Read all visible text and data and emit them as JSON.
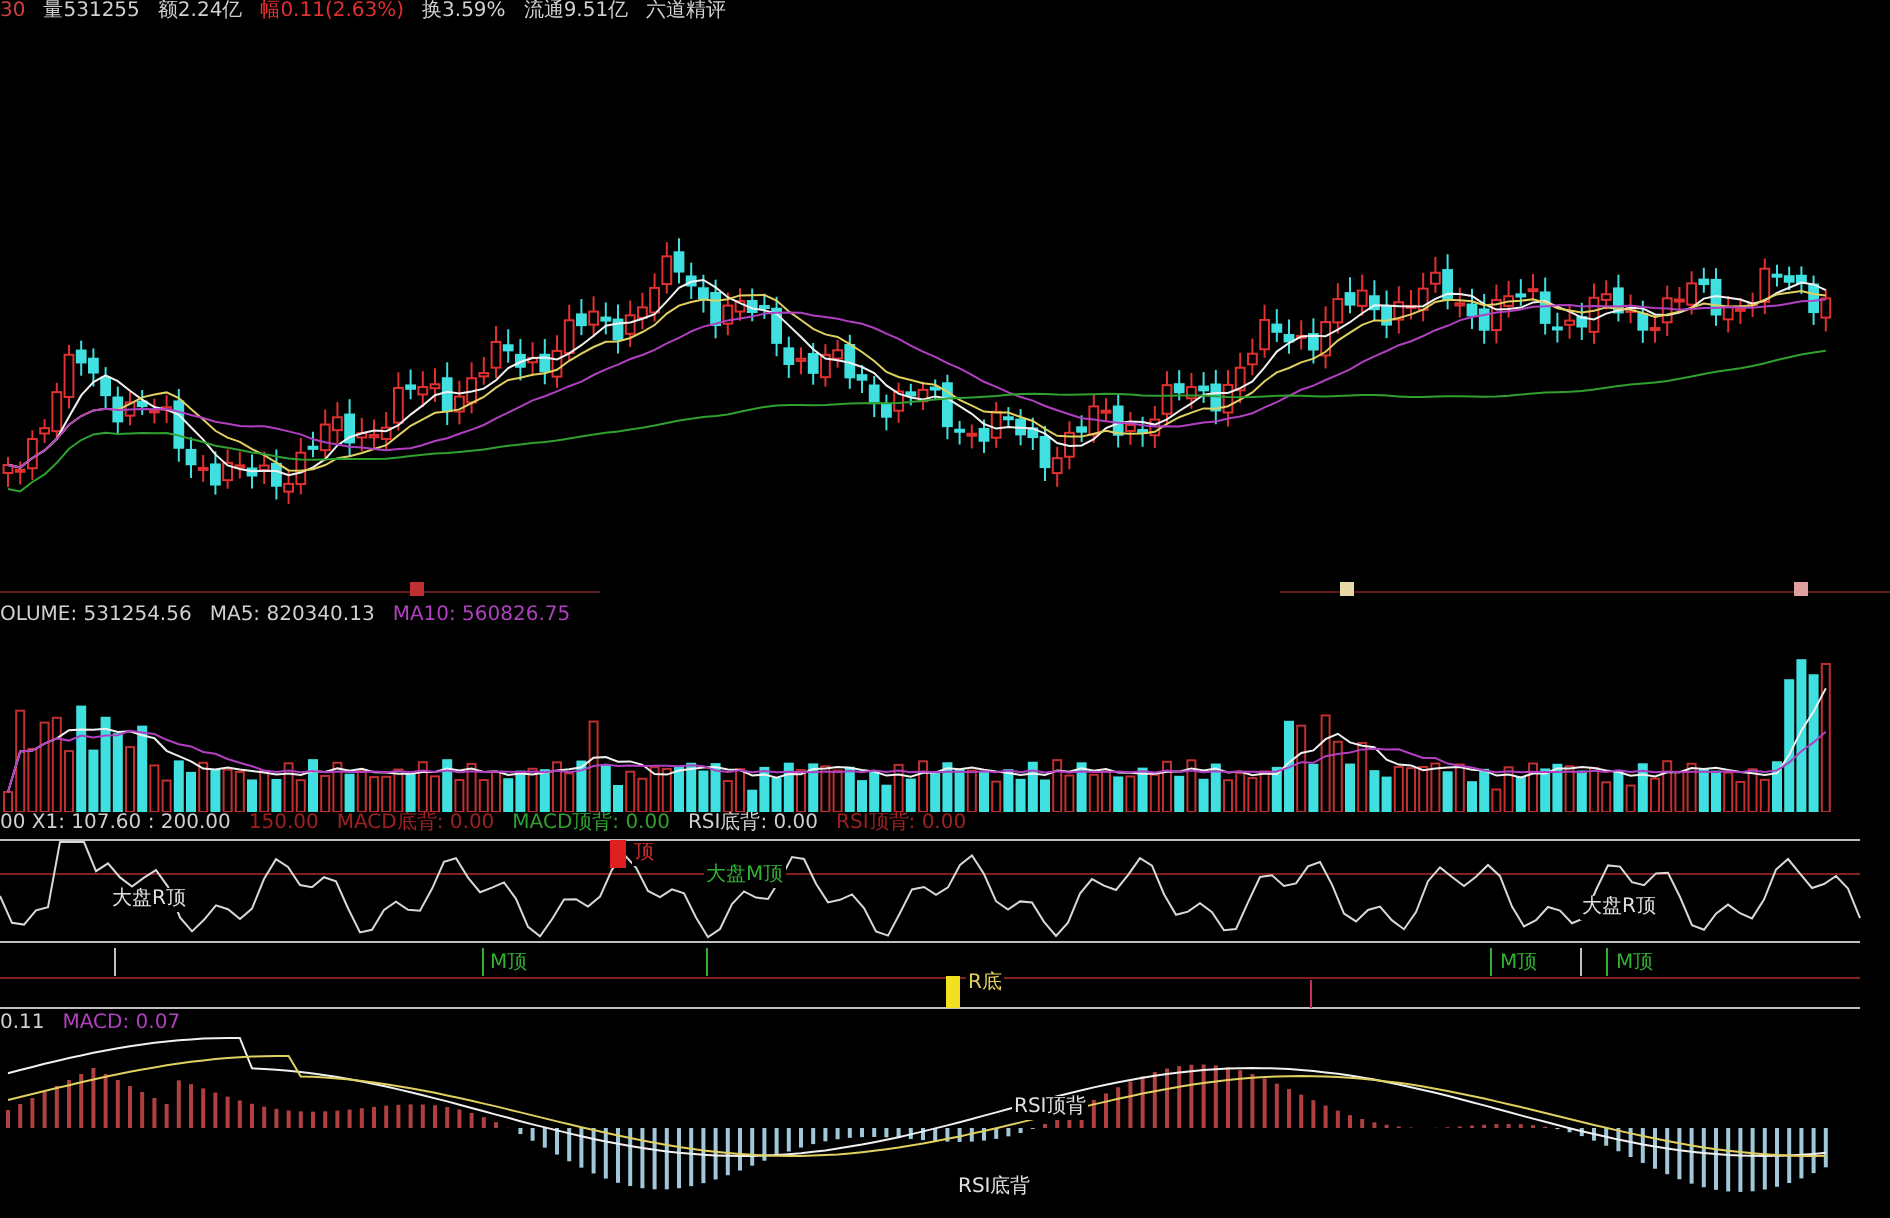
{
  "header": {
    "items": [
      {
        "text": "30",
        "color": "#d04040"
      },
      {
        "text": "量531255",
        "color": "#d0d0d0"
      },
      {
        "text": "额2.24亿",
        "color": "#d0d0d0"
      },
      {
        "text": "幅0.11(2.63%)",
        "color": "#e03030"
      },
      {
        "text": "换3.59%",
        "color": "#d0d0d0"
      },
      {
        "text": "流通9.51亿",
        "color": "#d0d0d0"
      },
      {
        "text": "六道精评",
        "color": "#d0d0d0"
      }
    ]
  },
  "price_panel": {
    "markers": [
      {
        "color": "#c03030"
      },
      {
        "color": "#e8d8a8"
      },
      {
        "color": "#e0a0a0"
      }
    ]
  },
  "volume_panel": {
    "legend": [
      {
        "text": "OLUME: 531254.56",
        "color": "#d0d0d0"
      },
      {
        "text": "MA5: 820340.13",
        "color": "#d0d0d0"
      },
      {
        "text": "MA10: 560826.75",
        "color": "#b040c0"
      }
    ]
  },
  "indicator_panel": {
    "legend": [
      {
        "text": "00 X1: 107.60 : 200.00",
        "color": "#d0d0d0"
      },
      {
        "text": "150.00",
        "color": "#a02020"
      },
      {
        "text": "MACD底背: 0.00",
        "color": "#a02020"
      },
      {
        "text": "MACD顶背: 0.00",
        "color": "#30a030"
      },
      {
        "text": "RSI底背: 0.00",
        "color": "#d0d0d0"
      },
      {
        "text": "RSI顶背: 0.00",
        "color": "#a02020"
      }
    ],
    "labels": [
      {
        "text": "大盘R顶",
        "color": "#e0e0e0"
      },
      {
        "text": "顶",
        "color": "#d03030"
      },
      {
        "text": "大盘M顶",
        "color": "#30b030"
      },
      {
        "text": "大盘R顶",
        "color": "#e0e0e0"
      },
      {
        "text": "M顶",
        "color": "#30b030"
      },
      {
        "text": "M顶",
        "color": "#30b030"
      },
      {
        "text": "M顶",
        "color": "#30b030"
      },
      {
        "text": "R底",
        "color": "#e0d060"
      }
    ]
  },
  "macd_panel": {
    "legend": [
      {
        "text": "0.11",
        "color": "#d0d0d0"
      },
      {
        "text": "MACD: 0.07",
        "color": "#b040c0"
      }
    ],
    "labels": [
      {
        "text": "RSI顶背",
        "color": "#e0e0e0"
      },
      {
        "text": "RSI底背",
        "color": "#e0e0e0"
      }
    ]
  }
}
